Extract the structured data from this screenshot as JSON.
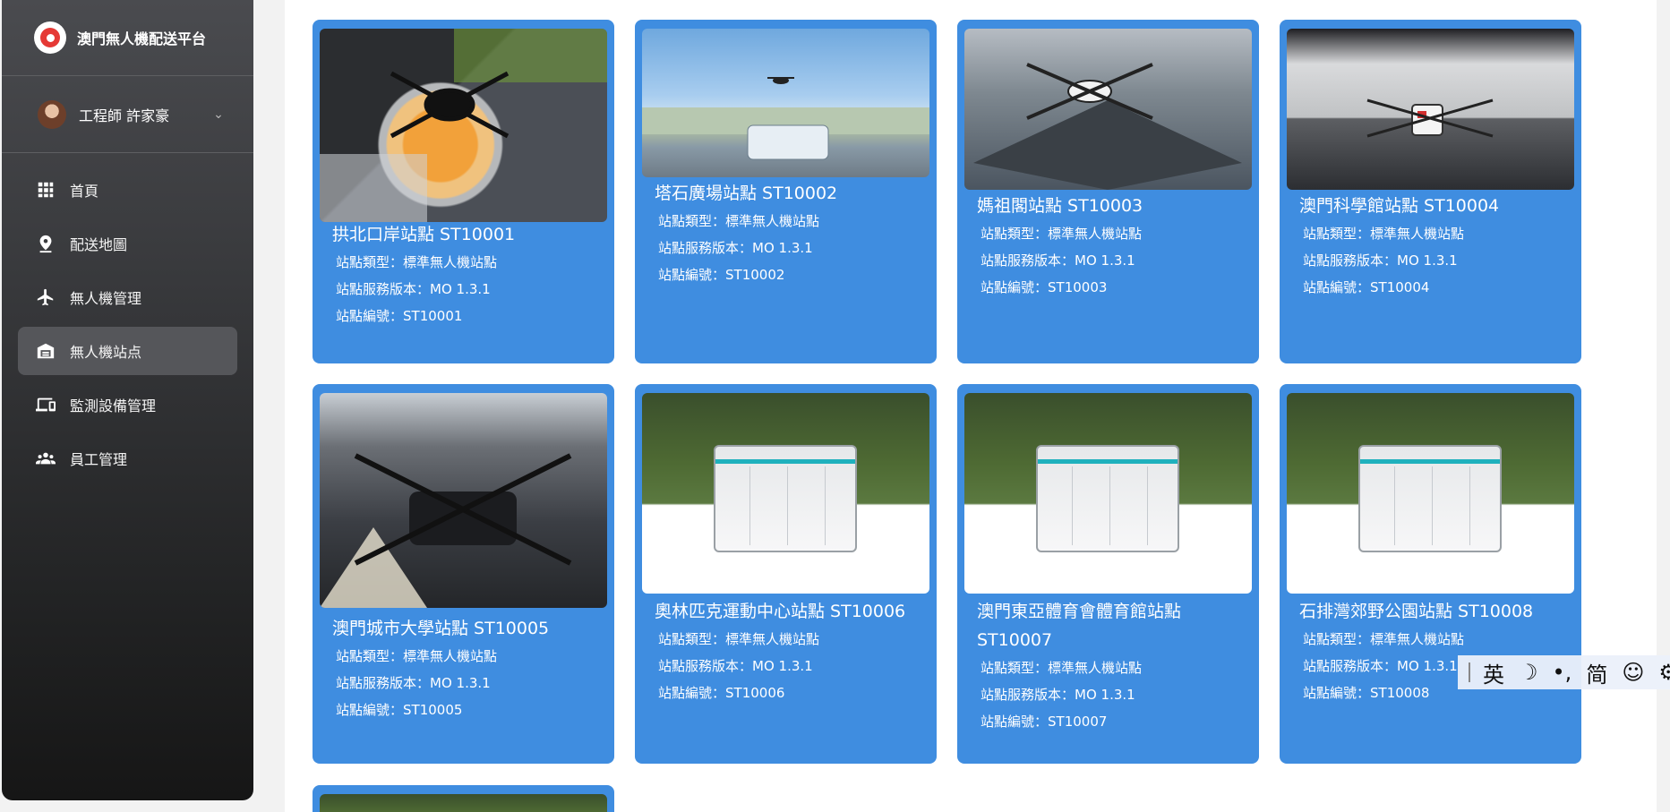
{
  "app": {
    "title": "澳門無人機配送平台"
  },
  "user": {
    "name": "工程師 許家豪"
  },
  "nav": [
    {
      "label": "首頁",
      "icon": "grid-icon"
    },
    {
      "label": "配送地圖",
      "icon": "map-pin-icon"
    },
    {
      "label": "無人機管理",
      "icon": "airplane-icon"
    },
    {
      "label": "無人機站点",
      "icon": "garage-icon",
      "active": true
    },
    {
      "label": "監測設備管理",
      "icon": "devices-icon"
    },
    {
      "label": "員工管理",
      "icon": "people-icon"
    }
  ],
  "field_labels": {
    "type": "站點類型：",
    "version": "站點服務版本：",
    "code": "站點編號："
  },
  "stations": [
    {
      "title": "拱北口岸站點 ST10001",
      "type": "標準無人機站點",
      "version": "MO 1.3.1",
      "code": "ST10001",
      "photo": "drone-on-solar-pad"
    },
    {
      "title": "塔石廣場站點 ST10002",
      "type": "標準無人機站點",
      "version": "MO 1.3.1",
      "code": "ST10002",
      "photo": "drone-over-rooftop"
    },
    {
      "title": "媽祖閣站點 ST10003",
      "type": "標準無人機站點",
      "version": "MO 1.3.1",
      "code": "ST10003",
      "photo": "drone-in-open-station"
    },
    {
      "title": "澳門科學館站點 ST10004",
      "type": "標準無人機站點",
      "version": "MO 1.3.1",
      "code": "ST10004",
      "photo": "drone-in-hangar"
    },
    {
      "title": "澳門城市大學站點 ST10005",
      "type": "標準無人機站點",
      "version": "MO 1.3.1",
      "code": "ST10005",
      "photo": "drone-on-street"
    },
    {
      "title": "奧林匹克運動中心站點 ST10006",
      "type": "標準無人機站點",
      "version": "MO 1.3.1",
      "code": "ST10006",
      "photo": "cabinet-station"
    },
    {
      "title": "澳門東亞體育會體育館站點 ST10007",
      "type": "標準無人機站點",
      "version": "MO 1.3.1",
      "code": "ST10007",
      "photo": "cabinet-station"
    },
    {
      "title": "石排灣郊野公園站點 ST10008",
      "type": "標準無人機站點",
      "version": "MO 1.3.1",
      "code": "ST10008",
      "photo": "cabinet-station"
    }
  ],
  "ime": {
    "lang": "英",
    "moon": "☽",
    "punct": "•,",
    "script": "简",
    "emoji": "☺",
    "settings": "⚙"
  }
}
